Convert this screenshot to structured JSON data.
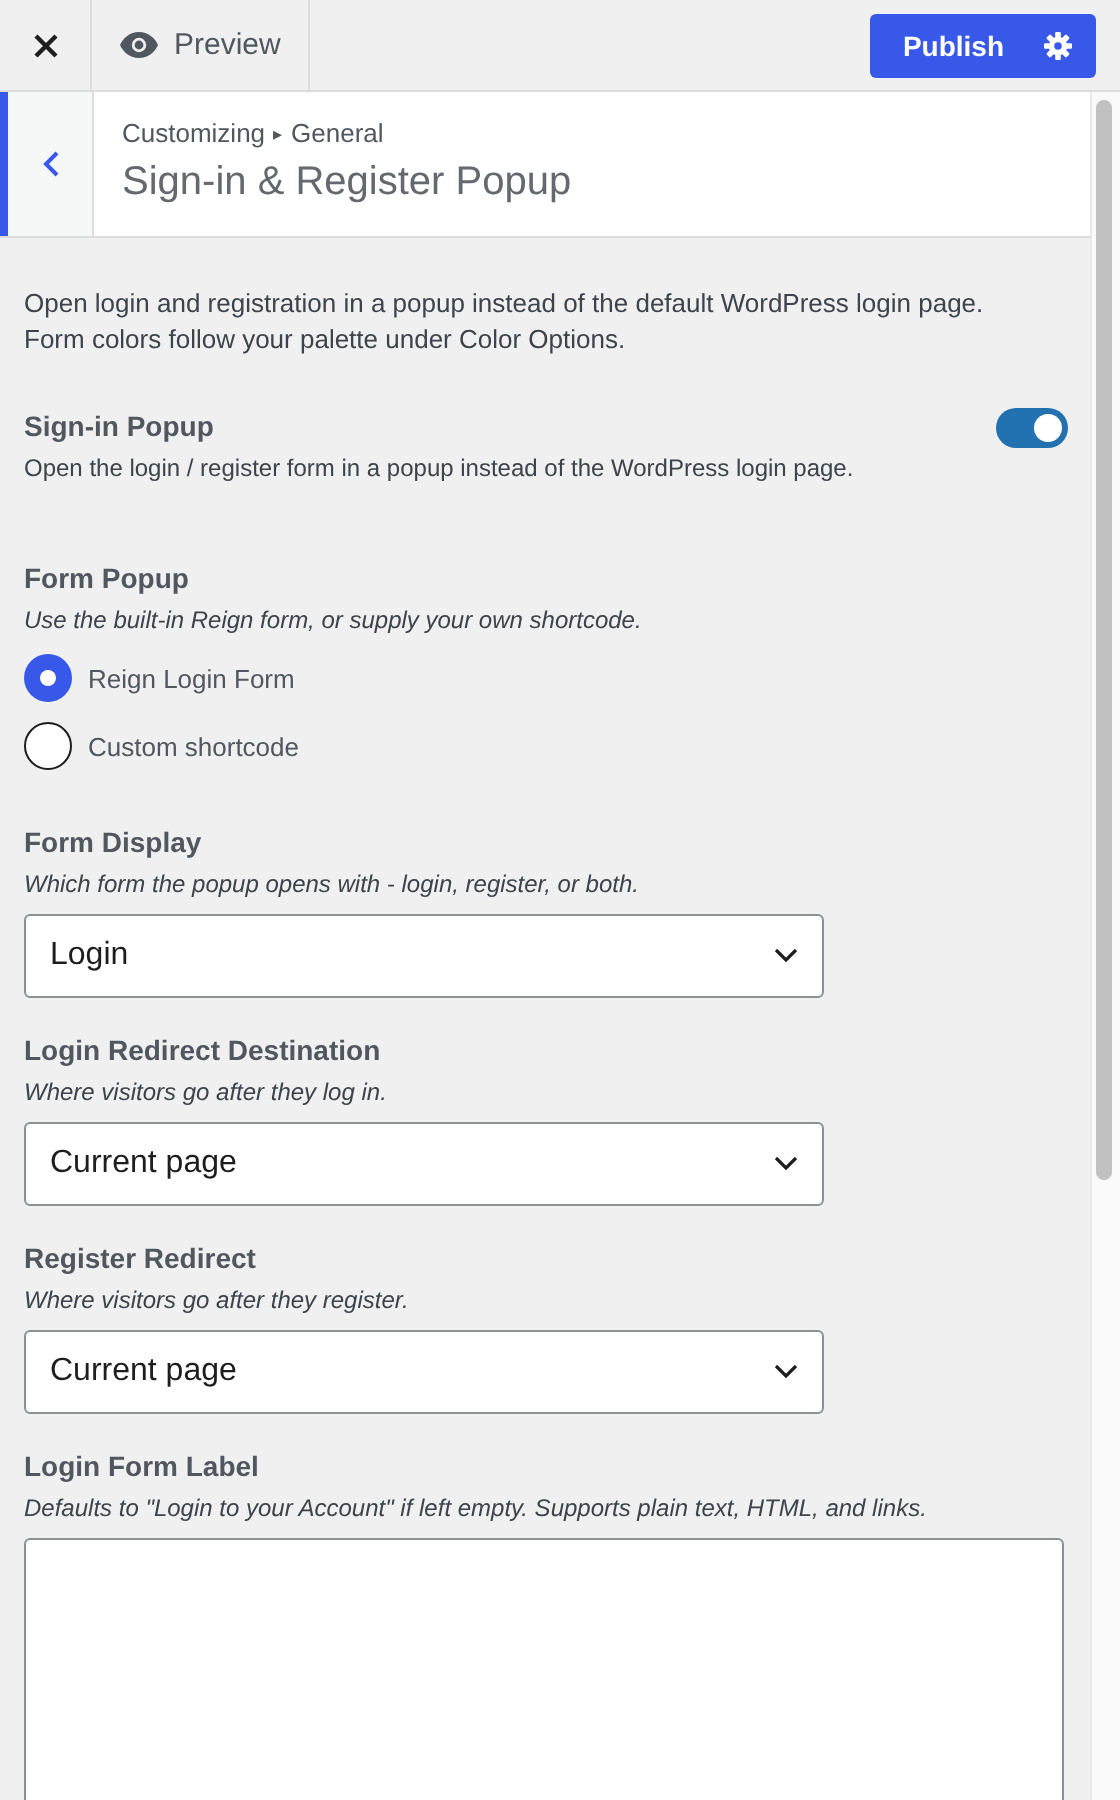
{
  "toolbar": {
    "preview": "Preview",
    "publish": "Publish"
  },
  "header": {
    "breadcrumb": "Customizing",
    "separator": "▸",
    "section": "General",
    "title": "Sign-in & Register Popup"
  },
  "intro": [
    "Open login and registration in a popup instead of the default WordPress login page.",
    "Form colors follow your palette under Color Options."
  ],
  "controls": [
    {
      "kind": "toggle",
      "label": "Sign-in Popup",
      "description": "Open the login / register form in a popup instead of the WordPress login page.",
      "on": true
    },
    {
      "kind": "radio",
      "label": "Form Popup",
      "description": "Use the built-in Reign form, or supply your own shortcode.",
      "options": [
        {
          "label": "Reign Login Form",
          "selected": true
        },
        {
          "label": "Custom shortcode",
          "selected": false
        }
      ]
    },
    {
      "kind": "select",
      "label": "Form Display",
      "description": "Which form the popup opens with - login, register, or both.",
      "value": "Login"
    },
    {
      "kind": "select",
      "label": "Login Redirect Destination",
      "description": "Where visitors go after they log in.",
      "value": "Current page"
    },
    {
      "kind": "select",
      "label": "Register Redirect",
      "description": "Where visitors go after they register.",
      "value": "Current page"
    },
    {
      "kind": "textarea",
      "label": "Login Form Label",
      "description": "Defaults to \"Login to your Account\" if left empty. Supports plain text, HTML, and links."
    }
  ]
}
